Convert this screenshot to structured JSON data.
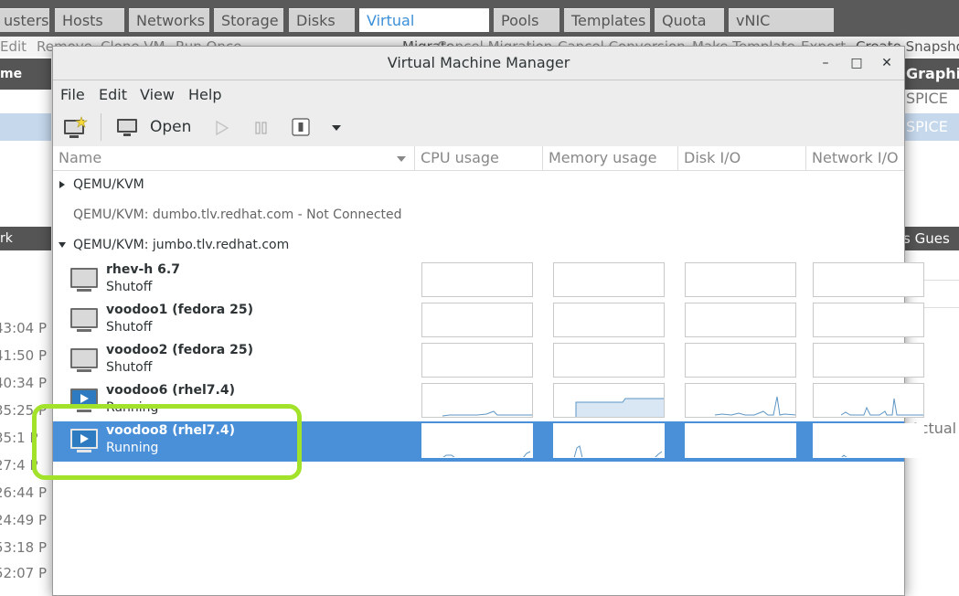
{
  "background_app": {
    "tabs": [
      "usters",
      "Hosts",
      "Networks",
      "Storage",
      "Disks",
      "Virtual Machines",
      "Pools",
      "Templates",
      "Quota",
      "vNIC Profiles"
    ],
    "active_tab": "Virtual Machines",
    "actions": [
      "Edit",
      "Remove",
      "Clone VM",
      "Run Once",
      "Migrate",
      "Cancel Migration",
      "Cancel Conversion",
      "Make Template",
      "Export",
      "Create Snapshot"
    ],
    "left_header": "me",
    "left_header2": "rk Interfa",
    "times": [
      "43:04 P",
      "41:50 P",
      "40:34 P",
      "35:25 P",
      "35:1 P",
      "27:4 P",
      "26:44 P",
      "24:49 P",
      "53:18 P",
      "52:07 P"
    ],
    "right_header": "Graphic",
    "right_values": [
      "SPICE",
      "SPICE"
    ],
    "right_header2": "s  Gues",
    "right_actual": ", Actual"
  },
  "window": {
    "title": "Virtual Machine Manager",
    "minimize": "–",
    "maximize": "□",
    "close": "✕"
  },
  "menu": [
    "File",
    "Edit",
    "View",
    "Help"
  ],
  "toolbar": {
    "open_label": "Open"
  },
  "columns": [
    "Name",
    "CPU usage",
    "Memory usage",
    "Disk I/O",
    "Network I/O"
  ],
  "connections": [
    {
      "label": "QEMU/KVM",
      "expanded": false
    },
    {
      "label": "QEMU/KVM: dumbo.tlv.redhat.com - Not Connected"
    },
    {
      "label": "QEMU/KVM: jumbo.tlv.redhat.com",
      "expanded": true
    }
  ],
  "vms": [
    {
      "name": "rhev-h 6.7",
      "state": "Shutoff"
    },
    {
      "name": "voodoo1 (fedora 25)",
      "state": "Shutoff"
    },
    {
      "name": "voodoo2 (fedora 25)",
      "state": "Shutoff"
    },
    {
      "name": "voodoo6 (rhel7.4)",
      "state": "Running"
    },
    {
      "name": "voodoo8 (rhel7.4)",
      "state": "Running",
      "selected": true
    }
  ],
  "colors": {
    "selection": "#4a90d9",
    "highlight": "#a3e22b",
    "graph_line": "#5e96c4"
  }
}
